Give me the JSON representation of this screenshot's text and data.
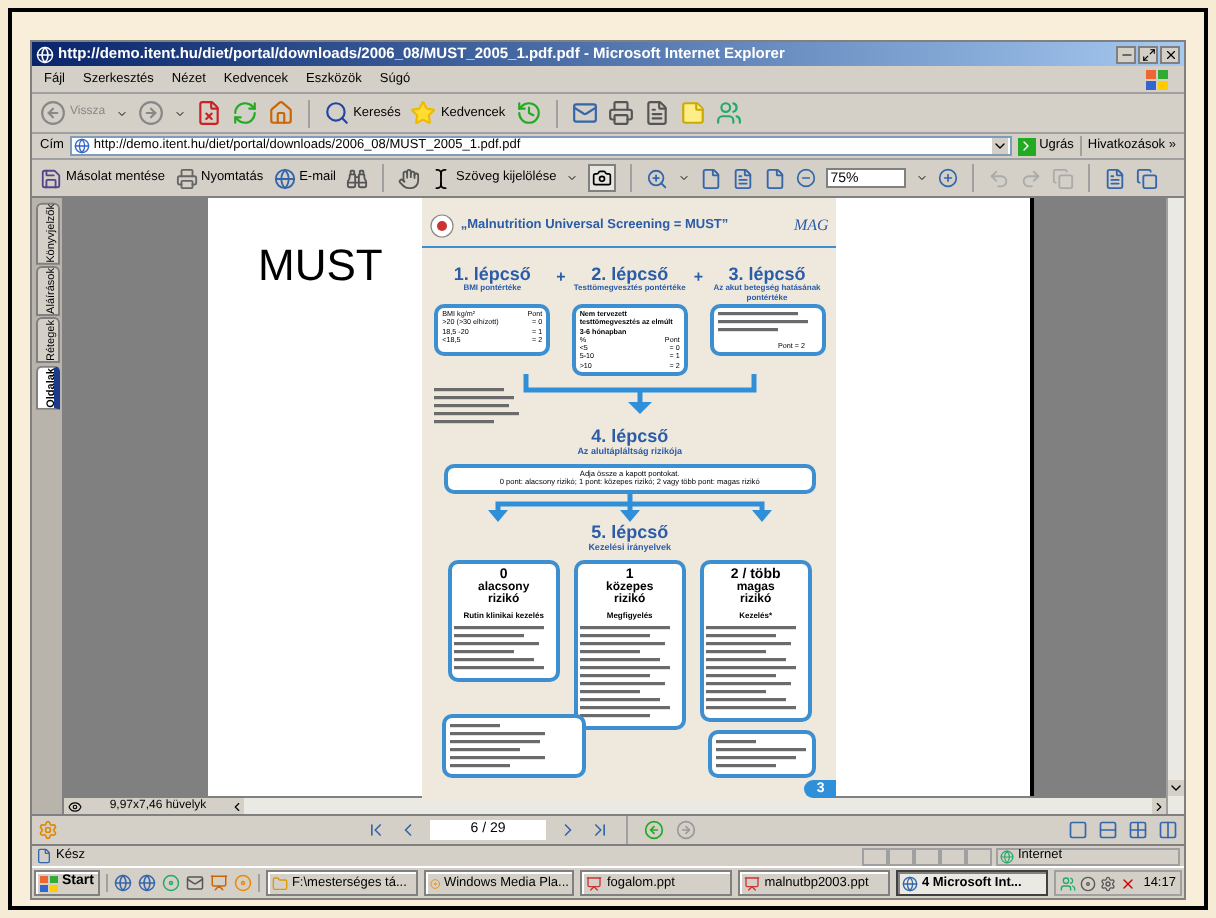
{
  "window": {
    "title": "http://demo.itent.hu/diet/portal/downloads/2006_08/MUST_2005_1.pdf.pdf - Microsoft Internet Explorer"
  },
  "menu": [
    "Fájl",
    "Szerkesztés",
    "Nézet",
    "Kedvencek",
    "Eszközök",
    "Súgó"
  ],
  "toolbar": {
    "back": "Vissza",
    "search": "Keresés",
    "favorites": "Kedvencek"
  },
  "address": {
    "label": "Cím",
    "value": "http://demo.itent.hu/diet/portal/downloads/2006_08/MUST_2005_1.pdf.pdf",
    "go": "Ugrás",
    "links": "Hivatkozások",
    "more": "»"
  },
  "pdf_toolbar": {
    "save": "Másolat mentése",
    "print": "Nyomtatás",
    "email": "E-mail",
    "select_text": "Szöveg kijelölése",
    "zoom": "75%"
  },
  "side_tabs": [
    {
      "label": "Könyvjelzők",
      "selected": false
    },
    {
      "label": "Aláírások",
      "selected": false
    },
    {
      "label": "Rétegek",
      "selected": false
    },
    {
      "label": "Oldalak",
      "selected": true
    }
  ],
  "slide": {
    "title": "MUST",
    "poster": {
      "title": "„Malnutrition Universal Screening = MUST”",
      "brand": "MAG",
      "plus": "+",
      "steps": [
        {
          "step": "1. lépcső",
          "subtitle": "BMI pontértéke",
          "box": {
            "head": [
              "BMI kg/m²",
              "Pont"
            ],
            "rows": [
              [
                ">20 (>30 elhízott)",
                "= 0"
              ],
              [
                "18,5 -20",
                "= 1"
              ],
              [
                "<18,5",
                "= 2"
              ]
            ]
          }
        },
        {
          "step": "2. lépcső",
          "subtitle": "Testtömegvesztés pontértéke",
          "box": {
            "note": "Nem tervezett testtömegvesztés az elmúlt 3-6 hónapban",
            "head": [
              "%",
              "Pont"
            ],
            "rows": [
              [
                "<5",
                "= 0"
              ],
              [
                "5-10",
                "= 1"
              ],
              [
                ">10",
                "= 2"
              ]
            ]
          }
        },
        {
          "step": "3. lépcső",
          "subtitle": "Az akut betegség hatásának pontértéke",
          "box": {
            "footer": "Pont = 2"
          }
        }
      ],
      "step4": {
        "step": "4. lépcső",
        "subtitle": "Az alultápláltság rizikója",
        "lines": [
          "Adja össze a kapott pontokat.",
          "0 pont: alacsony rizikó; 1 pont: közepes rizikó; 2 vagy több pont: magas rizikó"
        ]
      },
      "step5": {
        "step": "5. lépcső",
        "subtitle": "Kezelési irányelvek"
      },
      "risks": [
        {
          "score": "0",
          "level": "alacsony rizikó",
          "action": "Rutin klinikai kezelés"
        },
        {
          "score": "1",
          "level": "közepes rizikó",
          "action": "Megfigyelés"
        },
        {
          "score": "2 / több",
          "level": "magas rizikó",
          "action": "Kezelés*"
        }
      ],
      "page_number": "3"
    }
  },
  "page_size": "9,97x7,46 hüvelyk",
  "page_nav": "6 / 29",
  "status": {
    "text": "Kész",
    "zone": "Internet"
  },
  "taskbar": {
    "start": "Start",
    "tasks": [
      {
        "label": "F:\\mesterséges tá...",
        "selected": false,
        "kind": "folder"
      },
      {
        "label": "Windows Media Pla...",
        "selected": false,
        "kind": "media"
      },
      {
        "label": "fogalom.ppt",
        "selected": false,
        "kind": "ppt"
      },
      {
        "label": "malnutbp2003.ppt",
        "selected": false,
        "kind": "ppt"
      },
      {
        "label": "4 Microsoft Int...",
        "selected": true,
        "kind": "ie"
      }
    ],
    "clock": "14:17"
  }
}
